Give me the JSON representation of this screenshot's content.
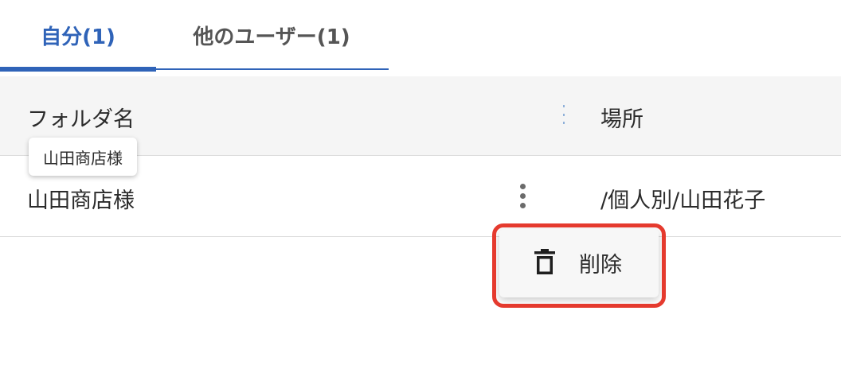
{
  "tabs": {
    "own_label": "自分(1)",
    "others_label": "他のユーザー(1)"
  },
  "table": {
    "headers": {
      "name": "フォルダ名",
      "location": "場所"
    },
    "rows": [
      {
        "name": "山田商店様",
        "location": "/個人別/山田花子"
      }
    ]
  },
  "tooltip": {
    "text": "山田商店様"
  },
  "context_menu": {
    "delete_label": "削除",
    "delete_icon": "trash-icon"
  },
  "colors": {
    "accent": "#2f63b8",
    "highlight": "#e53a2e"
  }
}
